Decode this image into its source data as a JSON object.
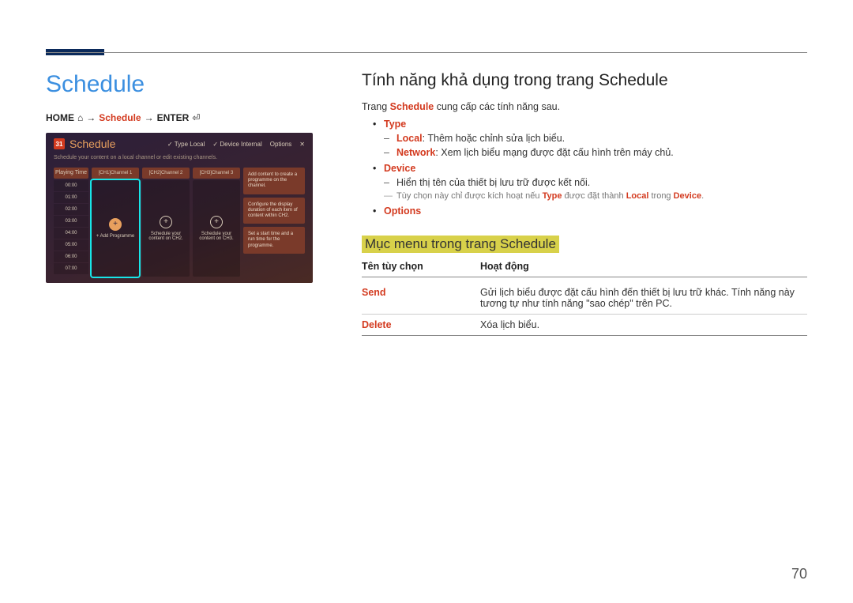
{
  "page_number": "70",
  "left": {
    "title": "Schedule",
    "breadcrumb": {
      "home": "HOME",
      "arrow": "→",
      "schedule": "Schedule",
      "enter": "ENTER",
      "home_icon": "⌂",
      "enter_icon": "⏎"
    },
    "screenshot": {
      "cal_day": "31",
      "title": "Schedule",
      "subtitle": "Schedule your content on a local channel or edit existing channels.",
      "top_right": {
        "type_label": "Type",
        "type_value": "Local",
        "device_label": "Device",
        "device_value": "Internal",
        "options": "Options"
      },
      "play_header": "Playing Time",
      "times": [
        "00:00",
        "01:00",
        "02:00",
        "03:00",
        "04:00",
        "05:00",
        "06:00",
        "07:00"
      ],
      "channels": {
        "ch1": {
          "hdr": "[CH1]Channel 1",
          "btn": "+ Add Programme"
        },
        "ch2": {
          "hdr": "[CH2]Channel 2",
          "btn": "Schedule your content on CH2."
        },
        "ch3": {
          "hdr": "[CH3]Channel 3",
          "btn": "Schedule your content on CH3."
        }
      },
      "cards": {
        "c1": "Add content to create a programme on the channel.",
        "c2": "Configure the display duration of each item of content within CH2.",
        "c3": "Set a start time and a run time for the programme."
      }
    }
  },
  "right": {
    "h2": "Tính năng khả dụng trong trang Schedule",
    "intro_pre": "Trang ",
    "intro_kw": "Schedule",
    "intro_post": " cung cấp các tính năng sau.",
    "features": {
      "type": {
        "name": "Type",
        "local": {
          "kw": "Local",
          "text": ": Thêm hoặc chỉnh sửa lịch biểu."
        },
        "network": {
          "kw": "Network",
          "text": ": Xem lịch biểu mạng được đặt cấu hình trên máy chủ."
        }
      },
      "device": {
        "name": "Device",
        "line": "Hiển thị tên của thiết bị lưu trữ được kết nối.",
        "note_pre": "Tùy chọn này chỉ được kích hoạt nếu ",
        "note_type": "Type",
        "note_mid": " được đặt thành ",
        "note_local": "Local",
        "note_in": " trong ",
        "note_device": "Device",
        "note_end": "."
      },
      "options": {
        "name": "Options"
      }
    },
    "menu": {
      "heading": "Mục menu trong trang Schedule",
      "th1": "Tên tùy chọn",
      "th2": "Hoạt động",
      "rows": [
        {
          "name": "Send",
          "desc": "Gửi lịch biểu được đặt cấu hình đến thiết bị lưu trữ khác. Tính năng này tương tự như tính năng \"sao chép\" trên PC."
        },
        {
          "name": "Delete",
          "desc": "Xóa lịch biểu."
        }
      ]
    }
  }
}
